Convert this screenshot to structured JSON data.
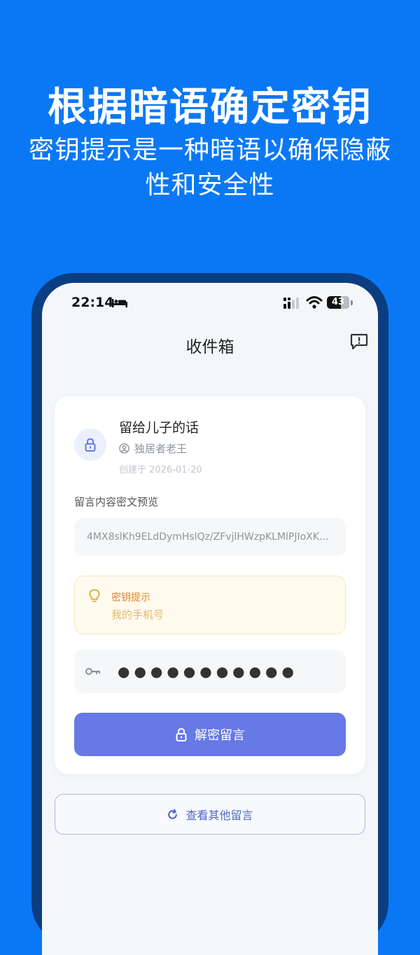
{
  "promo": {
    "title": "根据暗语确定密钥",
    "subtitle": "密钥提示是一种暗语以确保隐蔽性和安全性"
  },
  "status_bar": {
    "time": "22:14",
    "battery": "43"
  },
  "nav": {
    "title": "收件箱",
    "feedback_icon": "feedback-icon"
  },
  "message": {
    "title": "留给儿子的话",
    "author": "独居者老王",
    "created": "创建于 2026-01-20",
    "preview_label": "留言内容密文预览",
    "cipher_preview": "4MX8slKh9ELdDymHslQz/ZFvjlHWzpKLMlPJIoXK..."
  },
  "hint": {
    "label": "密钥提示",
    "value": "我的手机号"
  },
  "password": {
    "value": "●●●●●●●●●●●"
  },
  "buttons": {
    "decrypt": "解密留言",
    "view_other": "查看其他留言"
  },
  "colors": {
    "background": "#0a78f5",
    "primary_button": "#6679e4",
    "hint_text": "#d98a1e",
    "outline_button": "#5366c8"
  }
}
